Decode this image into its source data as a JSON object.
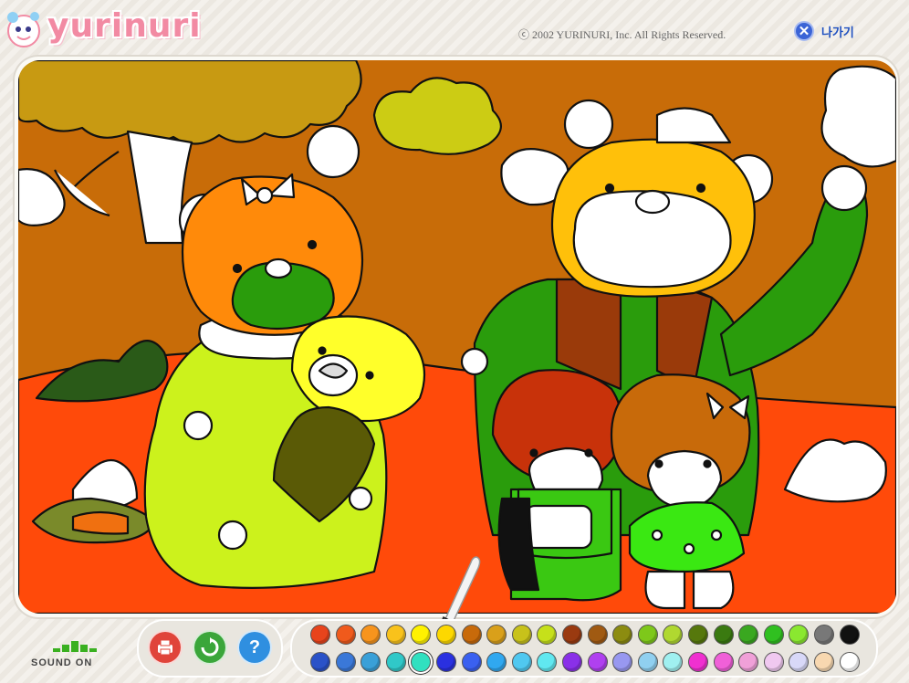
{
  "app": {
    "logo_text": "yurinuri",
    "copyright": "ⓒ 2002 YURINURI, Inc. All Rights Reserved.",
    "exit_label": "나가기"
  },
  "sound": {
    "label": "SOUND ON",
    "state": "on"
  },
  "tools": [
    {
      "name": "print-button",
      "icon": "printer-icon",
      "color": "#e0443a"
    },
    {
      "name": "reset-button",
      "icon": "refresh-icon",
      "color": "#3aa63a"
    },
    {
      "name": "help-button",
      "icon": "question-icon",
      "color": "#2f8fe0"
    }
  ],
  "palette": {
    "row1": [
      "#e8441c",
      "#f05a1c",
      "#f7941d",
      "#f9c21b",
      "#fff200",
      "#fdd800",
      "#c86a0a",
      "#d9a01a",
      "#c8c21a",
      "#c6e01a",
      "#9a3a10",
      "#a05a12",
      "#8c8c10",
      "#7ec81a",
      "#b0d830",
      "#56780c",
      "#3a7a10",
      "#3aa820",
      "#30c020",
      "#8ae830",
      "#787878",
      "#111111"
    ],
    "row2": [
      "#2a52c8",
      "#3a78d8",
      "#3aa0d8",
      "#30c8c8",
      "#30e0c0",
      "#2a30e0",
      "#3a60f0",
      "#30a8f0",
      "#50c8f0",
      "#60e8f0",
      "#8a30e8",
      "#b040f0",
      "#9898f0",
      "#90d0f0",
      "#a0f0f0",
      "#f030d0",
      "#f060d8",
      "#f0a0d8",
      "#f0c8f0",
      "#d8d8f8",
      "#f8d8b0",
      "#ffffff"
    ],
    "selected": "#30e0c0"
  }
}
